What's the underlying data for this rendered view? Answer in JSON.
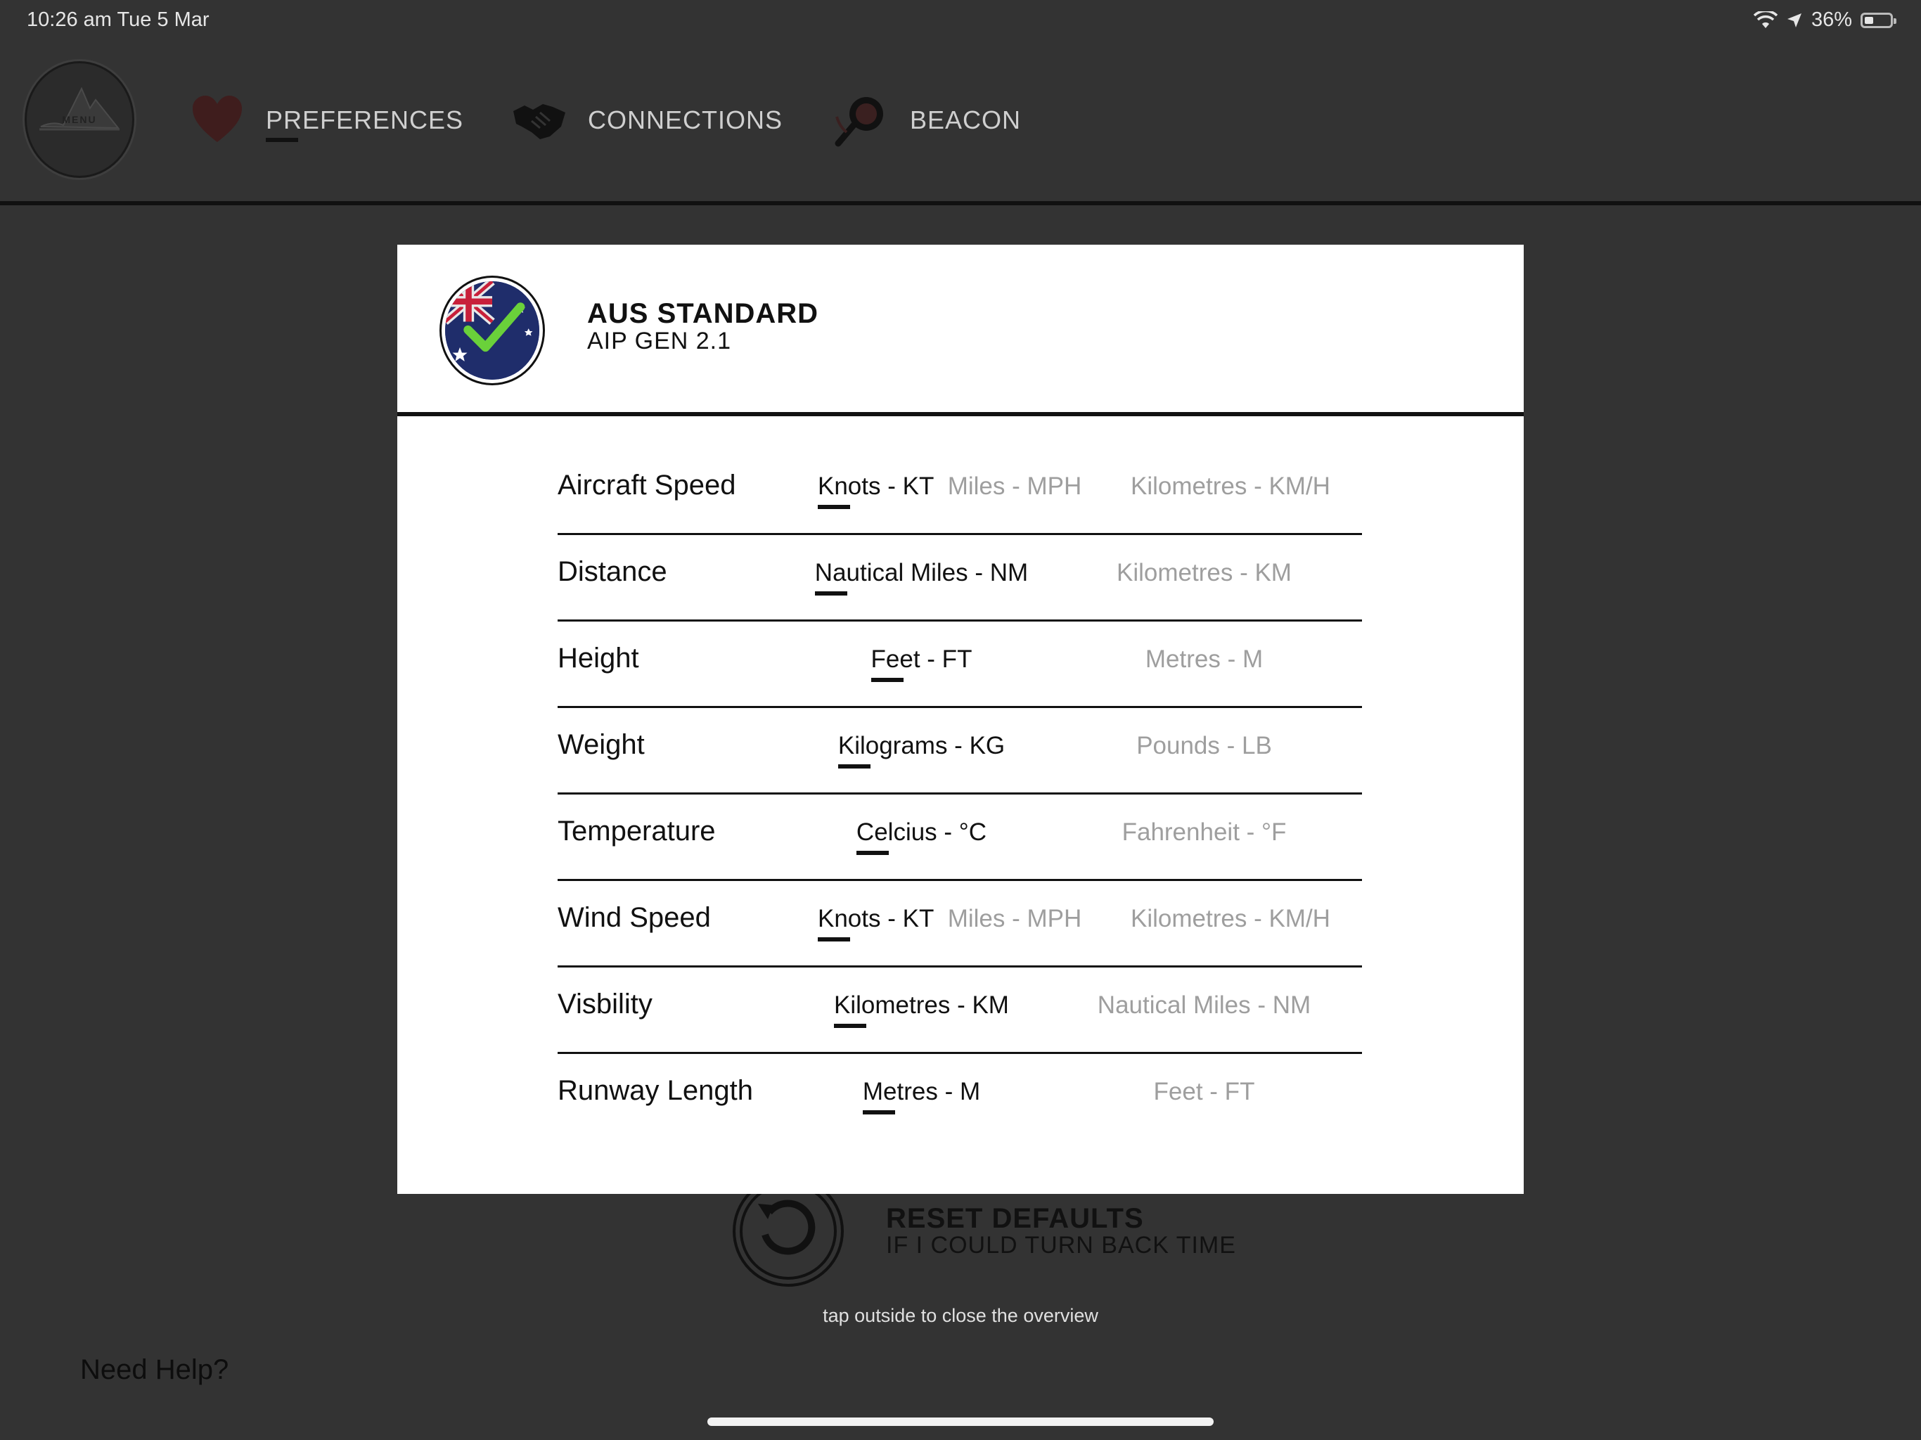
{
  "status_bar": {
    "time": "10:26 am   Tue 5 Mar",
    "battery": "36%",
    "battery_level": 0.36
  },
  "nav": {
    "logo_label": "MENU",
    "items": [
      {
        "label": "PREFERENCES",
        "icon": "heart-icon",
        "active": true
      },
      {
        "label": "CONNECTIONS",
        "icon": "handshake-icon",
        "active": false
      },
      {
        "label": "BEACON",
        "icon": "beacon-icon",
        "active": false
      }
    ]
  },
  "modal": {
    "title": "AUS STANDARD",
    "subtitle": "AIP GEN 2.1",
    "badge_icon": "australian-flag-check-icon",
    "rows": [
      {
        "label": "Aircraft Speed",
        "options": [
          "Knots - KT",
          "Miles - MPH",
          "Kilometres - KM/H"
        ],
        "selected": "Knots - KT"
      },
      {
        "label": "Distance",
        "options": [
          "Nautical Miles - NM",
          "Kilometres - KM"
        ],
        "selected": "Nautical Miles - NM"
      },
      {
        "label": "Height",
        "options": [
          "Feet - FT",
          "Metres - M"
        ],
        "selected": "Feet - FT"
      },
      {
        "label": "Weight",
        "options": [
          "Kilograms - KG",
          "Pounds - LB"
        ],
        "selected": "Kilograms - KG"
      },
      {
        "label": "Temperature",
        "options": [
          "Celcius - °C",
          "Fahrenheit - °F"
        ],
        "selected": "Celcius - °C"
      },
      {
        "label": "Wind Speed",
        "options": [
          "Knots - KT",
          "Miles - MPH",
          "Kilometres - KM/H"
        ],
        "selected": "Knots - KT"
      },
      {
        "label": "Visbility",
        "options": [
          "Kilometres - KM",
          "Nautical Miles - NM"
        ],
        "selected": "Kilometres - KM"
      },
      {
        "label": "Runway Length",
        "options": [
          "Metres - M",
          "Feet - FT"
        ],
        "selected": "Metres - M"
      }
    ]
  },
  "reset": {
    "title": "RESET DEFAULTS",
    "subtitle": "IF I COULD TURN BACK TIME",
    "icon": "reset-arrow-icon"
  },
  "hint": "tap outside to close the overview",
  "help_link": "Need Help?",
  "colors": {
    "background": "#333333",
    "modal": "#ffffff",
    "selected_text": "#111111",
    "unselected_text": "#9e9e9e",
    "heart": "#3a1a1a"
  }
}
